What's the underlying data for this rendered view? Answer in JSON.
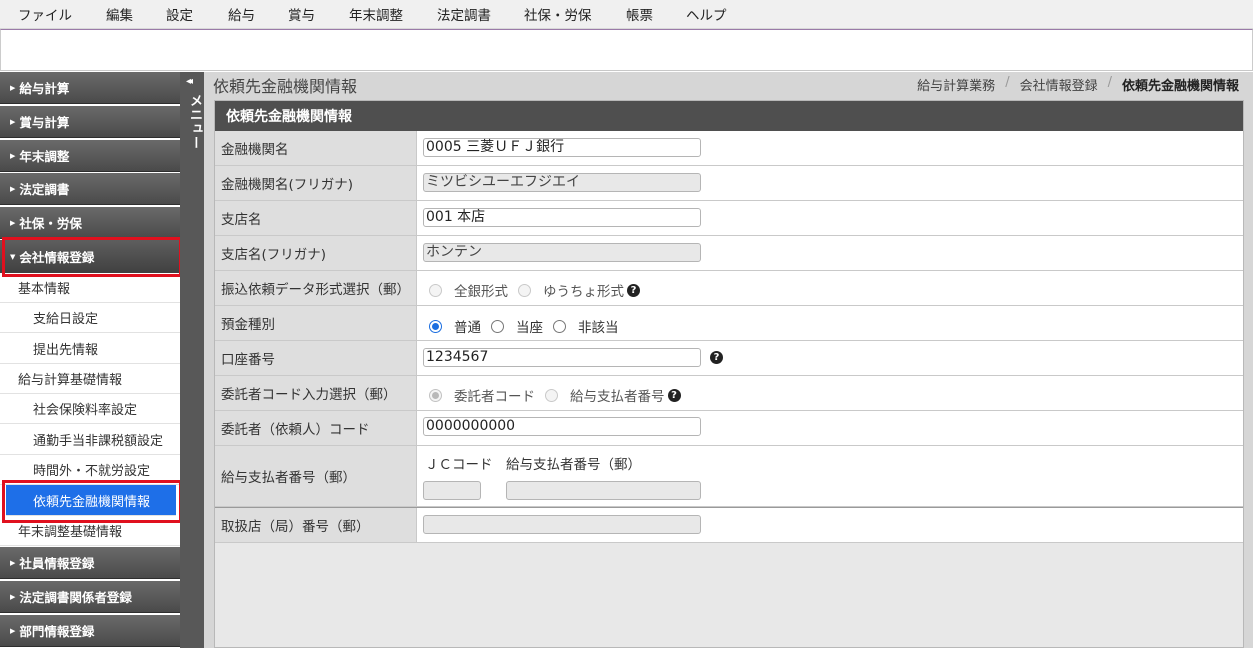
{
  "menubar": [
    "ファイル",
    "編集",
    "設定",
    "給与",
    "賞与",
    "年末調整",
    "法定調書",
    "社保・労保",
    "帳票",
    "ヘルプ"
  ],
  "sidebar": {
    "headers_top": [
      "給与計算",
      "賞与計算",
      "年末調整",
      "法定調書",
      "社保・労保"
    ],
    "open_header": "会社情報登録",
    "items": [
      {
        "label": "基本情報",
        "level": 1
      },
      {
        "label": "支給日設定",
        "level": 2
      },
      {
        "label": "提出先情報",
        "level": 2
      },
      {
        "label": "給与計算基礎情報",
        "level": 1
      },
      {
        "label": "社会保険料率設定",
        "level": 2
      },
      {
        "label": "通勤手当非課税額設定",
        "level": 2
      },
      {
        "label": "時間外・不就労設定",
        "level": 2
      },
      {
        "label": "依頼先金融機関情報",
        "level": 2,
        "active": true
      },
      {
        "label": "年末調整基礎情報",
        "level": 1
      }
    ],
    "headers_bottom": [
      "社員情報登録",
      "法定調書関係者登録",
      "部門情報登録"
    ]
  },
  "strip": {
    "arrow": "◂◂",
    "label": "メニュー"
  },
  "main": {
    "title": "依頼先金融機関情報",
    "breadcrumb": [
      "給与計算業務",
      "会社情報登録",
      "依頼先金融機関情報"
    ],
    "panel_title": "依頼先金融機関情報"
  },
  "form": {
    "bank_name": {
      "label": "金融機関名",
      "value": "0005 三菱ＵＦＪ銀行"
    },
    "bank_kana": {
      "label": "金融機関名(フリガナ)",
      "value": "ミツビシユーエフジエイ"
    },
    "branch_name": {
      "label": "支店名",
      "value": "001 本店"
    },
    "branch_kana": {
      "label": "支店名(フリガナ)",
      "value": "ホンテン"
    },
    "data_format": {
      "label": "振込依頼データ形式選択（郵）",
      "opt1": "全銀形式",
      "opt2": "ゆうちょ形式"
    },
    "deposit_type": {
      "label": "預金種別",
      "opt1": "普通",
      "opt2": "当座",
      "opt3": "非該当",
      "selected": "普通"
    },
    "account_no": {
      "label": "口座番号",
      "value": "1234567"
    },
    "consignor_select": {
      "label": "委託者コード入力選択（郵）",
      "opt1": "委託者コード",
      "opt2": "給与支払者番号"
    },
    "consignor_code": {
      "label": "委託者（依頼人）コード",
      "value": "0000000000"
    },
    "payer_no": {
      "label": "給与支払者番号（郵）",
      "sub1": "ＪＣコード",
      "sub2": "給与支払者番号（郵）",
      "v1": "",
      "v2": ""
    },
    "handling_office": {
      "label": "取扱店（局）番号（郵）",
      "value": ""
    }
  },
  "help_glyph": "?"
}
